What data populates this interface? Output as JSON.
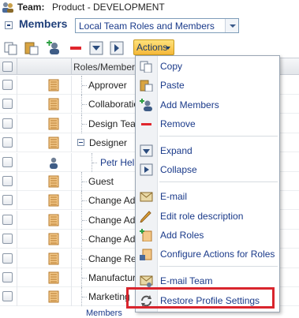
{
  "title": {
    "label": "Team:",
    "value": "Product - DEVELOPMENT"
  },
  "members": {
    "heading": "Members",
    "view_selected": "Local Team Roles and Members"
  },
  "toolbar": {
    "actions_label": "Actions"
  },
  "grid": {
    "header": "Roles/Members",
    "rows": [
      {
        "label": "Approver",
        "type": "role"
      },
      {
        "label": "Collaboration",
        "type": "role"
      },
      {
        "label": "Design Team",
        "type": "role"
      },
      {
        "label": "Designer",
        "type": "role-expanded"
      },
      {
        "label": "Petr Hel",
        "type": "person"
      },
      {
        "label": "Guest",
        "type": "role"
      },
      {
        "label": "Change Adm",
        "type": "role"
      },
      {
        "label": "Change Adm",
        "type": "role"
      },
      {
        "label": "Change Adm",
        "type": "role"
      },
      {
        "label": "Change Re",
        "type": "role"
      },
      {
        "label": "Manufactur",
        "type": "role"
      },
      {
        "label": "Marketing",
        "type": "role"
      }
    ],
    "partial_row": "Members"
  },
  "menu": {
    "items": [
      {
        "label": "Copy",
        "icon": "copy-icon"
      },
      {
        "label": "Paste",
        "icon": "paste-icon"
      },
      {
        "label": "Add Members",
        "icon": "add-members-icon"
      },
      {
        "label": "Remove",
        "icon": "remove-icon"
      },
      {
        "label": "Expand",
        "icon": "expand-icon"
      },
      {
        "label": "Collapse",
        "icon": "collapse-icon"
      },
      {
        "label": "E-mail",
        "icon": "email-icon"
      },
      {
        "label": "Edit role description",
        "icon": "pencil-icon"
      },
      {
        "label": "Add Roles",
        "icon": "add-roles-icon"
      },
      {
        "label": "Configure Actions for Roles",
        "icon": "configure-actions-icon"
      },
      {
        "label": "E-mail Team",
        "icon": "email-team-icon"
      },
      {
        "label": "Restore Profile Settings",
        "icon": "restore-icon"
      }
    ]
  },
  "colors": {
    "highlight": "#d9252d",
    "actions_button": "#f5b83a",
    "link_text": "#1a3a8a"
  }
}
